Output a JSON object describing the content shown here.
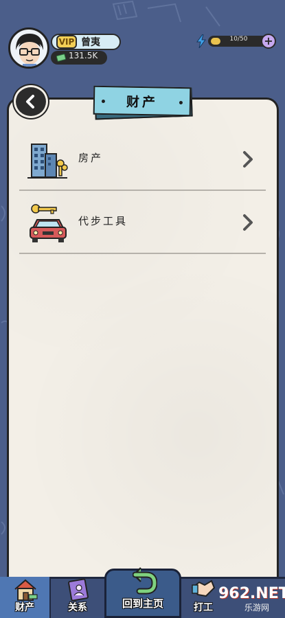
{
  "header": {
    "vip_badge": "VIP",
    "player_name": "曾夷",
    "cash": "131.5K",
    "energy": "10/50",
    "plus_label": "+"
  },
  "panel": {
    "title": "财产",
    "items": [
      {
        "label": "房产",
        "icon": "building-with-keys-icon"
      },
      {
        "label": "代步工具",
        "icon": "car-with-key-icon"
      }
    ]
  },
  "bottom_nav": {
    "tabs": [
      {
        "label": "财产",
        "icon": "house-icon",
        "active": true
      },
      {
        "label": "关系",
        "icon": "contact-book-icon",
        "active": false
      },
      {
        "label": "回到主页",
        "icon": "return-arrow-icon",
        "active": false
      },
      {
        "label": "打工",
        "icon": "handshake-icon",
        "active": false
      }
    ]
  },
  "watermark": {
    "brand": "962.NET",
    "caption": "乐游网"
  },
  "colors": {
    "background": "#4b5e8a",
    "paper": "#f3efe7",
    "banner": "#8fd3e3",
    "vip": "#f3cf55",
    "nav": "#3d4f78"
  }
}
